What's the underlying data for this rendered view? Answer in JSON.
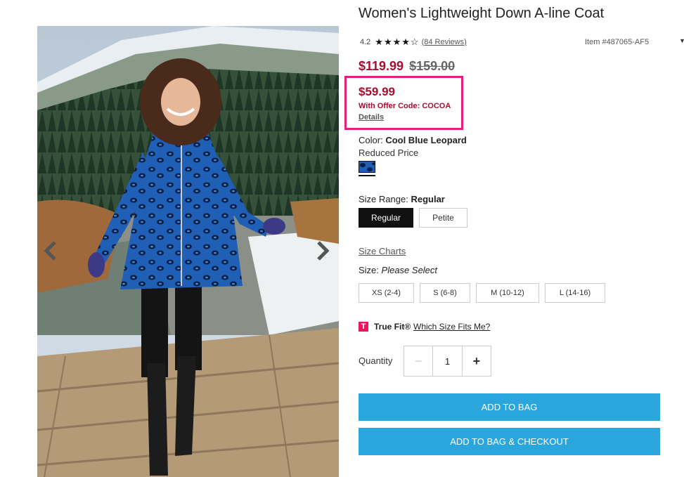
{
  "product": {
    "title": "Women's Lightweight Down A-line Coat",
    "rating": "4.2",
    "stars_filled": 4,
    "stars_total": 5,
    "reviews_label": "(84 Reviews)",
    "item_number": "Item #487065-AF5"
  },
  "price": {
    "sale": "$119.99",
    "original": "$159.00"
  },
  "offer": {
    "price": "$59.99",
    "code_text": "With Offer Code: COCOA",
    "details_label": "Details",
    "highlight_color": "#e3207b"
  },
  "color": {
    "label": "Color:",
    "value": "Cool Blue Leopard",
    "note": "Reduced Price"
  },
  "size_range": {
    "label": "Size Range:",
    "value": "Regular",
    "options": [
      "Regular",
      "Petite"
    ],
    "selected": "Regular"
  },
  "size": {
    "charts_label": "Size Charts",
    "label": "Size:",
    "value": "Please Select",
    "options": [
      "XS (2-4)",
      "S (6-8)",
      "M (10-12)",
      "L (14-16)"
    ]
  },
  "truefit": {
    "icon": "T",
    "brand": "True Fit®",
    "link": "Which Size Fits Me?"
  },
  "quantity": {
    "label": "Quantity",
    "value": "1",
    "minus": "−",
    "plus": "+"
  },
  "actions": {
    "add_to_bag": "ADD TO BAG",
    "add_to_bag_checkout": "ADD TO BAG & CHECKOUT",
    "button_color": "#2aa6dc"
  },
  "icons": {
    "prev": "chevron-left-icon",
    "next": "chevron-right-icon",
    "star": "star-icon",
    "dropdown": "caret-down-icon"
  },
  "colors": {
    "sale_price": "#a50f2d",
    "selected_button": "#111111"
  }
}
